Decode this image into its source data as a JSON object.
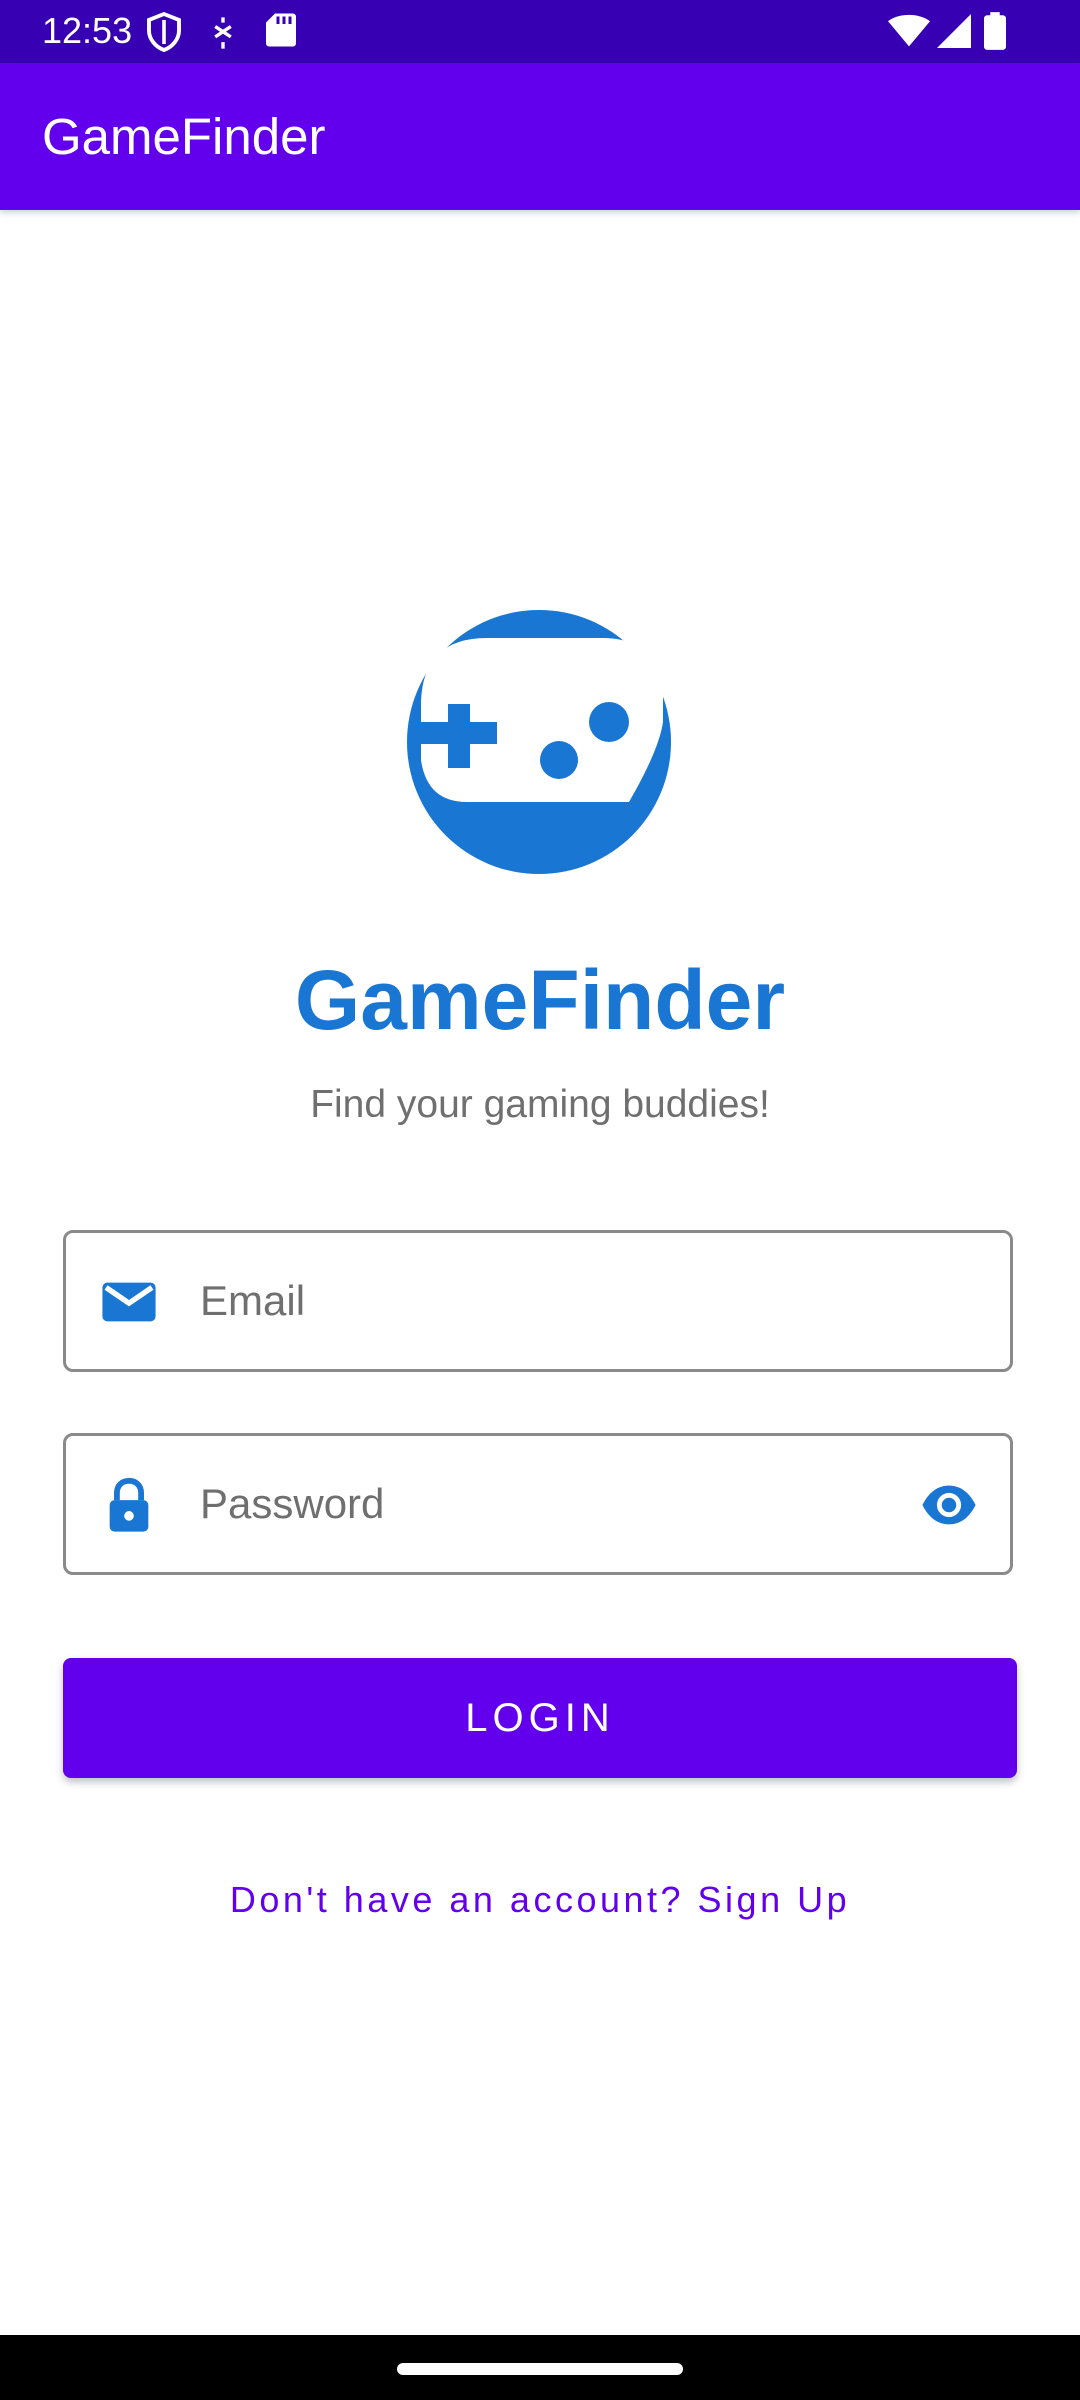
{
  "status_bar": {
    "time": "12:53",
    "left_icons": [
      "shield-icon",
      "notification-icon",
      "sd-card-icon"
    ],
    "right_icons": [
      "wifi-icon",
      "signal-icon",
      "battery-icon"
    ]
  },
  "app_bar": {
    "title": "GameFinder"
  },
  "header": {
    "logo_icon": "gamepad-icon",
    "title": "GameFinder",
    "tagline": "Find your gaming buddies!"
  },
  "form": {
    "email": {
      "icon": "email-icon",
      "placeholder": "Email",
      "value": ""
    },
    "password": {
      "icon": "lock-icon",
      "placeholder": "Password",
      "value": "",
      "toggle_icon": "eye-icon"
    },
    "login_label": "LOGIN",
    "signup_label": "Don't have an account? Sign Up"
  },
  "colors": {
    "status_bar": "#3700B3",
    "primary": "#6200EE",
    "accent_blue": "#1976D2",
    "tagline_gray": "#6F6F6F"
  }
}
